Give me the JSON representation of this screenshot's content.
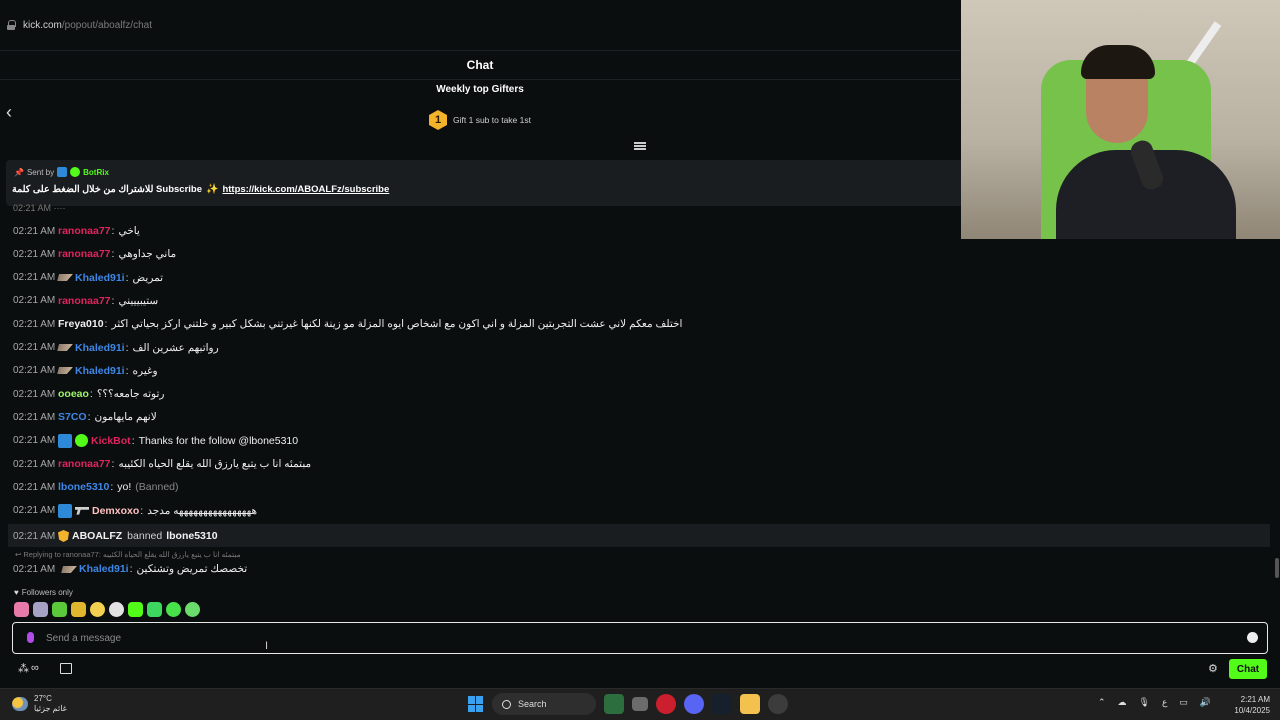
{
  "browser": {
    "host": "kick.com",
    "path": "/popout/aboalfz/chat"
  },
  "header": {
    "title": "Chat"
  },
  "gifters": {
    "title": "Weekly top Gifters",
    "rank": "1",
    "text": "Gift 1 sub to take 1st"
  },
  "pinned": {
    "sent_by_label": "Sent by",
    "sender": "BotRix",
    "message": "للاشتراك من خلال الضغط على كلمة Subscribe",
    "link": "https://kick.com/ABOALFz/subscribe"
  },
  "messages": [
    {
      "time": "02:21 AM",
      "user": "ranonaa77",
      "color": "#e0245e",
      "text": "ياخي"
    },
    {
      "time": "02:21 AM",
      "user": "ranonaa77",
      "color": "#e0245e",
      "text": "ماني جداوهي"
    },
    {
      "time": "02:21 AM",
      "user": "Khaled91i",
      "color": "#3f87e6",
      "badge": "og",
      "text": "تمريض"
    },
    {
      "time": "02:21 AM",
      "user": "ranonaa77",
      "color": "#e0245e",
      "text": "ستيبيييني"
    },
    {
      "time": "02:21 AM",
      "user": "Freya010",
      "color": "#f2f2f2",
      "text": "اختلف معكم لاني عشت التجربتين المزلة و اني اكون مع اشخاص ايوه المزلة مو زينة لكنها غيرتني بشكل كبير و خلتني اركز بحياتي اكثر"
    },
    {
      "time": "02:21 AM",
      "user": "Khaled91i",
      "color": "#3f87e6",
      "badge": "og",
      "text": "رواتبهم عشرين الف"
    },
    {
      "time": "02:21 AM",
      "user": "Khaled91i",
      "color": "#3f87e6",
      "badge": "og",
      "text": "وغيره"
    },
    {
      "time": "02:21 AM",
      "user": "ooeao",
      "color": "#9ff56b",
      "text": "رتوته جامعه؟؟؟"
    },
    {
      "time": "02:21 AM",
      "user": "S7CO",
      "color": "#3f87e6",
      "text": "لانهم مايهامون"
    },
    {
      "time": "02:21 AM",
      "user": "KickBot",
      "color": "#e0245e",
      "badge": "bot",
      "text": "Thanks for the follow @lbone5310"
    },
    {
      "time": "02:21 AM",
      "user": "ranonaa77",
      "color": "#e0245e",
      "text": "مبتمئه انا ب يتبع يارزق الله يقلع الحياه الكئيبه"
    },
    {
      "time": "02:21 AM",
      "user": "lbone5310",
      "color": "#3f87e6",
      "text": "yo!",
      "banned": "(Banned)"
    },
    {
      "time": "02:21 AM",
      "user": "Demxoxo",
      "color": "#ffc0c0",
      "badge": "pistol",
      "text": "ههههههههههههههههه مدجد"
    }
  ],
  "mod_action": {
    "time": "02:21 AM",
    "mod": "ABOALFZ",
    "action": "banned",
    "target": "lbone5310"
  },
  "reply": {
    "note": "Replying to ranonaa77: مبتمئه انا ب يتبع يارزق الله يقلع الحياه الكئيبه",
    "time": "02:21 AM",
    "user": "Khaled91i",
    "color": "#3f87e6",
    "text": "تخصصك تمريض وتشتكين"
  },
  "followers_only": "Followers only",
  "input": {
    "placeholder": "Send a message"
  },
  "chat_button": "Chat",
  "taskbar": {
    "temp": "27°C",
    "weather_text": "غائم جزئيا",
    "search": "Search",
    "lang": "ع",
    "time": "2:21 AM",
    "date": "10/4/2025"
  },
  "colors": {
    "accent": "#53fc18",
    "bg": "#0b0e0f"
  }
}
